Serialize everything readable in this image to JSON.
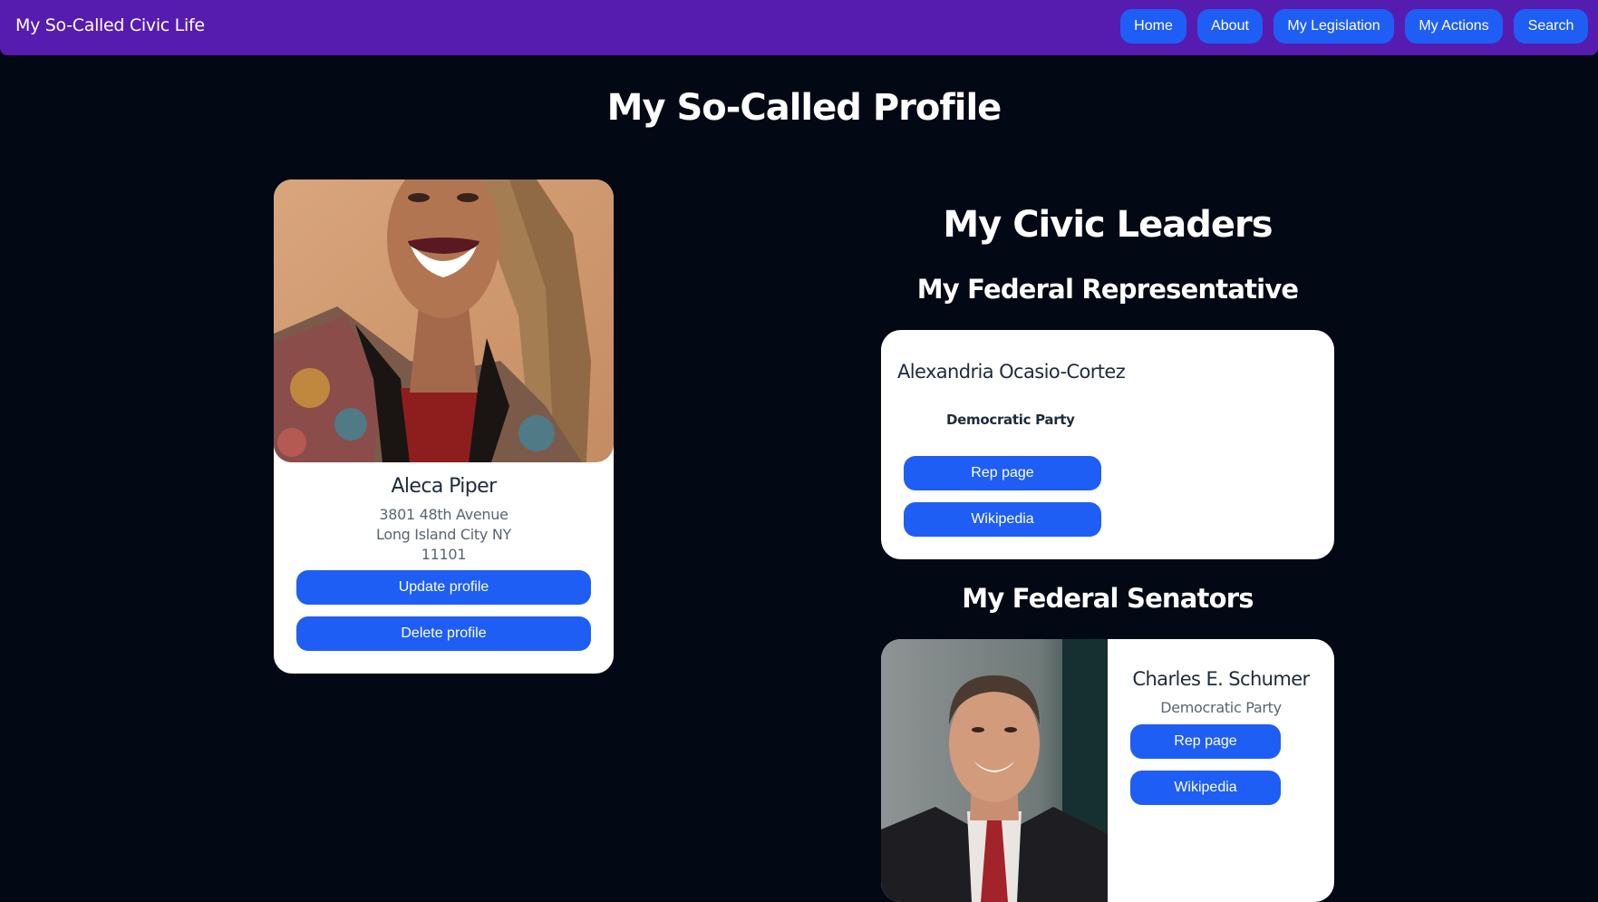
{
  "nav": {
    "brand": "My So-Called Civic Life",
    "links": [
      "Home",
      "About",
      "My Legislation",
      "My Actions",
      "Search"
    ]
  },
  "page_title": "My So-Called Profile",
  "profile": {
    "photo_icon": "user-photo",
    "name": "Aleca Piper",
    "address_line1": "3801 48th Avenue",
    "address_line2": "Long Island City NY",
    "address_line3": "11101",
    "update_label": "Update profile",
    "delete_label": "Delete profile"
  },
  "leaders": {
    "title": "My Civic Leaders",
    "rep_section_title": "My Federal Representative",
    "representative": {
      "name": "Alexandria Ocasio-Cortez",
      "party": "Democratic Party",
      "rep_page_label": "Rep page",
      "wikipedia_label": "Wikipedia"
    },
    "senators_section_title": "My Federal Senators",
    "senator": {
      "photo_icon": "senator-photo",
      "name": "Charles E. Schumer",
      "party": "Democratic Party",
      "rep_page_label": "Rep page",
      "wikipedia_label": "Wikipedia"
    }
  },
  "colors": {
    "navbar": "#561caf",
    "accent": "#1f5ef5",
    "background": "#020814",
    "card": "#ffffff"
  }
}
